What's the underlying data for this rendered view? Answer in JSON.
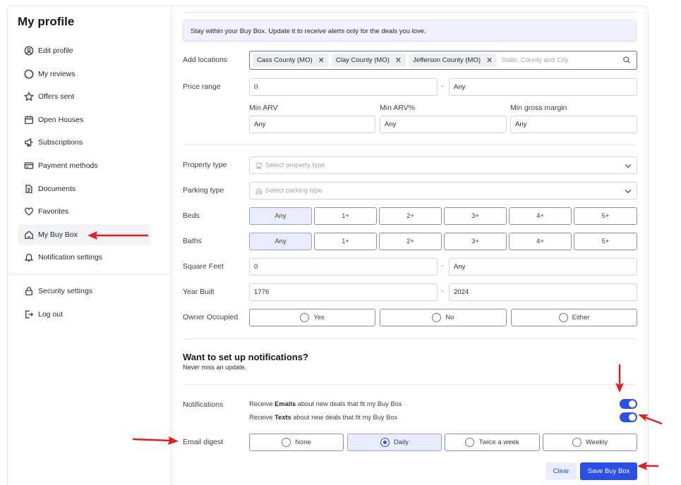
{
  "sidebar": {
    "title": "My profile",
    "items": [
      {
        "label": "Edit profile",
        "icon": "user-circle-icon"
      },
      {
        "label": "My reviews",
        "icon": "badge-star-icon"
      },
      {
        "label": "Offers sent",
        "icon": "star-icon"
      },
      {
        "label": "Open Houses",
        "icon": "calendar-icon"
      },
      {
        "label": "Subscriptions",
        "icon": "megaphone-icon"
      },
      {
        "label": "Payment methods",
        "icon": "credit-card-icon"
      },
      {
        "label": "Documents",
        "icon": "document-icon"
      },
      {
        "label": "Favorites",
        "icon": "heart-icon"
      },
      {
        "label": "My Buy Box",
        "icon": "home-icon"
      },
      {
        "label": "Notification settings",
        "icon": "bell-icon"
      }
    ],
    "secondary": [
      {
        "label": "Security settings",
        "icon": "lock-icon"
      },
      {
        "label": "Log out",
        "icon": "logout-icon"
      }
    ]
  },
  "main": {
    "info": "Stay within your Buy Box. Update it to receive alerts only for the deals you love.",
    "locations": {
      "label": "Add locations",
      "chips": [
        "Cass County (MO)",
        "Clay County (MO)",
        "Jefferson County (MO)"
      ],
      "placeholder": "State, County and City"
    },
    "price_range": {
      "label": "Price range",
      "min": "0",
      "max": "Any",
      "sep": "-"
    },
    "min_arv": {
      "label": "Min ARV",
      "value": "Any"
    },
    "min_arv_pct": {
      "label": "Min ARV%",
      "value": "Any"
    },
    "min_gross_margin": {
      "label": "Min gross margin",
      "value": "Any"
    },
    "property_type": {
      "label": "Property type",
      "placeholder": "Select property type"
    },
    "parking_type": {
      "label": "Parking type",
      "placeholder": "Select parking type"
    },
    "beds": {
      "label": "Beds",
      "options": [
        "Any",
        "1+",
        "2+",
        "3+",
        "4+",
        "5+"
      ],
      "selected": "Any"
    },
    "baths": {
      "label": "Baths",
      "options": [
        "Any",
        "1+",
        "2+",
        "3+",
        "4+",
        "5+"
      ],
      "selected": "Any"
    },
    "square_feet": {
      "label": "Square Feet",
      "min": "0",
      "max": "Any",
      "sep": "-"
    },
    "year_built": {
      "label": "Year Built",
      "min": "1776",
      "max": "2024",
      "sep": "-"
    },
    "owner_occupied": {
      "label": "Owner Occupied",
      "options": [
        "Yes",
        "No",
        "Either"
      ]
    },
    "notifications_section": {
      "title": "Want to set up notifications?",
      "subtitle": "Never miss an update."
    },
    "notifications": {
      "label": "Notifications",
      "email_pre": "Receive ",
      "email_bold": "Emails",
      "email_post": " about new deals that fit my Buy Box",
      "text_pre": "Receive ",
      "text_bold": "Texts",
      "text_post": " about new deals that fit my Buy Box",
      "email_on": true,
      "text_on": true
    },
    "email_digest": {
      "label": "Email digest",
      "options": [
        "None",
        "Daily",
        "Twice a week",
        "Weekly"
      ],
      "selected": "Daily"
    },
    "buttons": {
      "clear": "Clear",
      "save": "Save Buy Box"
    }
  },
  "colors": {
    "accent": "#2b50e6",
    "annotation_arrow": "#e11d1d"
  }
}
